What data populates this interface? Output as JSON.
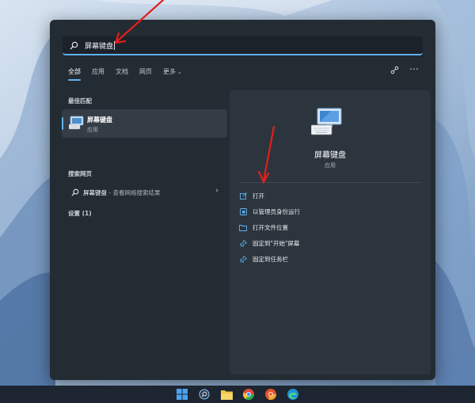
{
  "search": {
    "query": "屏幕键盘"
  },
  "tabs": [
    {
      "label": "全部"
    },
    {
      "label": "应用"
    },
    {
      "label": "文档"
    },
    {
      "label": "网页"
    },
    {
      "label": "更多"
    }
  ],
  "left": {
    "best_match_heading": "最佳匹配",
    "best_match": {
      "title": "屏幕键盘",
      "subtitle": "应用"
    },
    "web_heading": "搜索网页",
    "web_result": {
      "query": "屏幕键盘",
      "suffix": " - 查看网络搜索结果"
    },
    "settings_heading": "设置 (1)"
  },
  "right": {
    "app_title": "屏幕键盘",
    "app_subtitle": "应用",
    "actions": [
      {
        "label": "打开",
        "icon": "open-icon"
      },
      {
        "label": "以管理员身份运行",
        "icon": "shield-icon"
      },
      {
        "label": "打开文件位置",
        "icon": "folder-icon"
      },
      {
        "label": "固定到\"开始\"屏幕",
        "icon": "pin-icon"
      },
      {
        "label": "固定到任务栏",
        "icon": "pin-icon"
      }
    ]
  },
  "colors": {
    "accent": "#5fb2f2",
    "panel": "#232b33",
    "arrow": "#e0201d"
  }
}
